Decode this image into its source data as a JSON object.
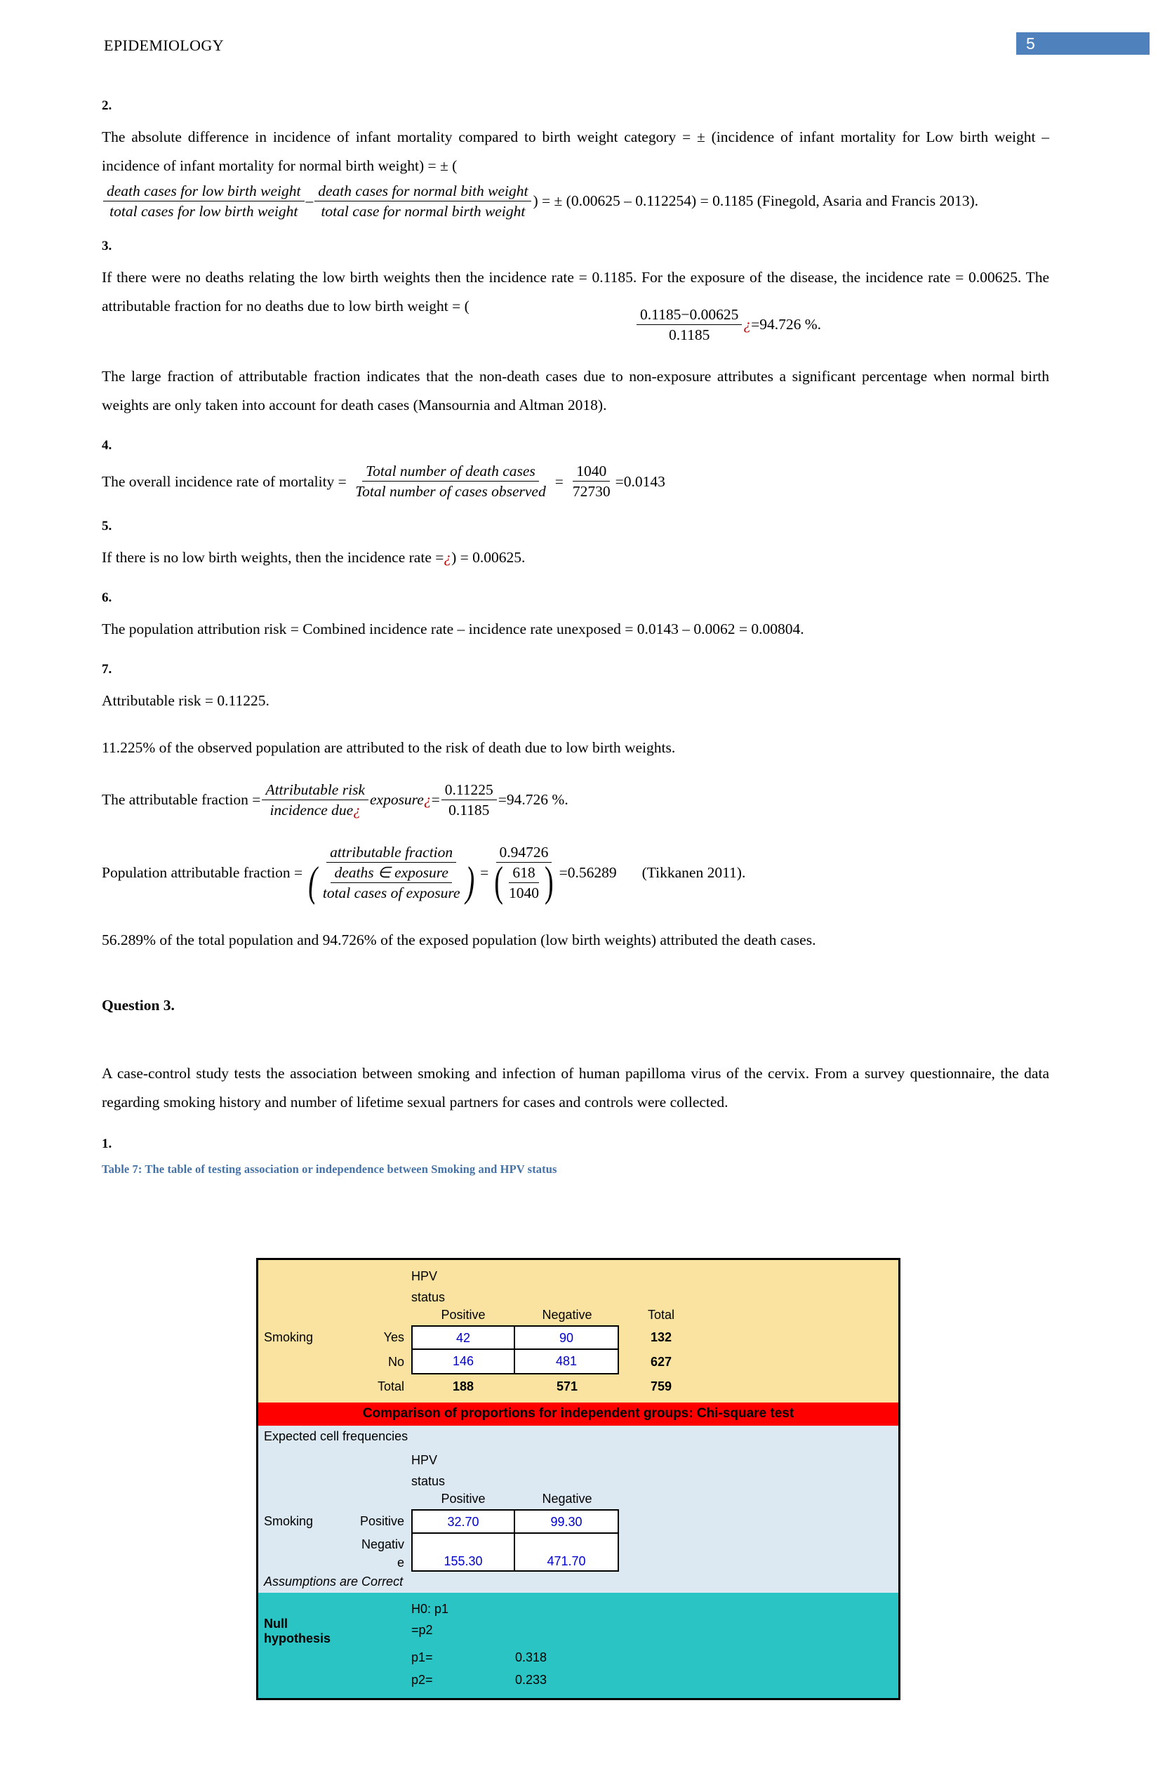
{
  "header": {
    "title": "EPIDEMIOLOGY",
    "page_number": "5",
    "badge_color": "#4f81bd"
  },
  "sections": {
    "s2": {
      "number": "2.",
      "para_a": "The absolute difference in incidence of infant mortality compared to birth weight category = ± (incidence of infant mortality for Low birth weight – incidence of infant mortality for normal birth weight) = ± (",
      "frac1_num": "death cases for low birth weight",
      "frac1_den": "total cases for low birth weight",
      "minus": "–",
      "frac2_num": "death cases for normal bith weight",
      "frac2_den": "total case for normal birth weight",
      "tail": ") = ± (0.00625 – 0.112254) = 0.1185 (Finegold, Asaria and Francis 2013)."
    },
    "s3": {
      "number": "3.",
      "lead": "If there were no deaths relating the low birth weights then the incidence rate = 0.1185. For the exposure of the disease, the incidence rate = 0.00625. The attributable fraction for no deaths due to low birth weight = (",
      "frac_num": "0.1185−0.00625",
      "frac_den": "0.1185",
      "err": "¿",
      "tail": "=94.726 %.",
      "para_b": "The large fraction of attributable fraction indicates that the non-death cases due to non-exposure attributes a significant percentage when normal birth weights are only taken into account for death cases (Mansournia and Altman 2018)."
    },
    "s4": {
      "number": "4.",
      "lead": "The overall incidence rate of mortality = ",
      "frac1_num": "Total number of death cases",
      "frac1_den": "Total number of cases observed",
      "eq": "=",
      "frac2_num": "1040",
      "frac2_den": "72730",
      "tail": "=0.0143"
    },
    "s5": {
      "number": "5.",
      "lead": "If there is no low birth weights, then the incidence rate =",
      "err": "¿",
      "tail": ") = 0.00625."
    },
    "s6": {
      "number": "6.",
      "text": "The population attribution risk = Combined incidence rate – incidence rate unexposed = 0.0143 – 0.0062 = 0.00804."
    },
    "s7": {
      "number": "7.",
      "text": "Attributable risk = 0.11225.",
      "para_pct": "11.225% of the observed population are attributed to the risk of death due to low birth weights.",
      "af_lead": "The attributable fraction =",
      "af_frac_num": "Attributable risk",
      "af_frac_den": "incidence due",
      "af_err1": "¿",
      "af_mid": "exposure",
      "af_err2": "¿",
      "af_eq": "=",
      "af_frac2_num": "0.11225",
      "af_frac2_den": "0.1185",
      "af_tail": "=94.726 %.",
      "paf_lead": "Population attributable fraction =",
      "paf_num": "attributable fraction",
      "paf_den_num": "deaths ∈ exposure",
      "paf_den_den": "total cases of exposure",
      "paf_eq": "=",
      "paf_r_num": "0.94726",
      "paf_r_den_num": "618",
      "paf_r_den_den": "1040",
      "paf_tail": "=0.56289",
      "paf_cite": "(Tikkanen 2011).",
      "summary": "56.289% of the total population and 94.726% of the exposed population (low birth weights) attributed the death cases."
    }
  },
  "question3": {
    "heading": "Question 3.",
    "intro": "A case-control study tests the association between smoking and infection of human papilloma virus of the cervix. From a survey questionnaire, the data regarding smoking history and number of lifetime sexual partners for cases and controls were collected.",
    "item_number": "1.",
    "table_caption": "Table 7: The table of testing association or independence between Smoking and HPV status"
  },
  "sheet": {
    "observed": {
      "group_header_line1": "HPV",
      "group_header_line2": "status",
      "col_positive": "Positive",
      "col_negative": "Negative",
      "col_total": "Total",
      "row_label": "Smoking",
      "rows": [
        {
          "sub": "Yes",
          "positive": "42",
          "negative": "90",
          "total": "132"
        },
        {
          "sub": "No",
          "positive": "146",
          "negative": "481",
          "total": "627"
        }
      ],
      "total_row": {
        "sub": "Total",
        "positive": "188",
        "negative": "571",
        "total": "759"
      }
    },
    "banner": "Comparison of proportions for independent groups: Chi-square test",
    "expected": {
      "title": "Expected cell frequencies",
      "group_header_line1": "HPV",
      "group_header_line2": "status",
      "col_positive": "Positive",
      "col_negative": "Negative",
      "row_label": "Smoking",
      "rows": [
        {
          "sub": "Positive",
          "sub2": "",
          "positive": "32.70",
          "negative": "99.30"
        },
        {
          "sub": "Negativ",
          "sub2": "e",
          "positive": "155.30",
          "negative": "471.70"
        }
      ],
      "assumptions": "Assumptions are Correct"
    },
    "hypothesis": {
      "label": "Null hypothesis",
      "h0_line1": "H0: p1",
      "h0_line2": "=p2",
      "p1_label": "p1=",
      "p1_value": "0.318",
      "p2_label": "p2=",
      "p2_value": "0.233"
    },
    "colors": {
      "yellow": "#fae3a0",
      "red": "#ff0000",
      "blue": "#dce9f2",
      "teal": "#2bc4c4",
      "cell_text": "#0000cc"
    }
  }
}
